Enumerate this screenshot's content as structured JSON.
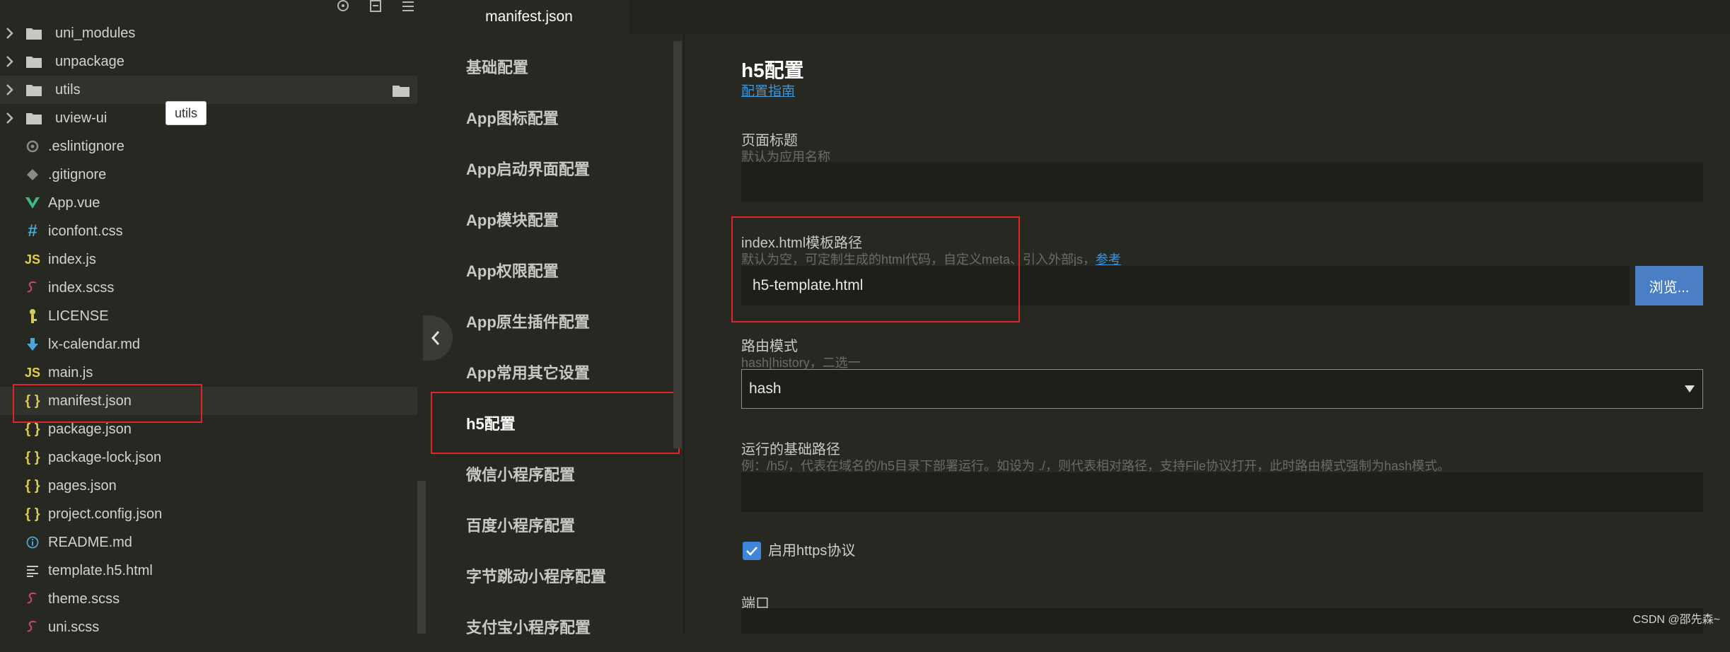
{
  "sidebar": {
    "folders": [
      {
        "name": "uni_modules"
      },
      {
        "name": "unpackage"
      },
      {
        "name": "utils"
      },
      {
        "name": "uview-ui"
      }
    ],
    "files": [
      {
        "name": ".eslintignore",
        "icon": "gear-file-icon"
      },
      {
        "name": ".gitignore",
        "icon": "git-diamond-icon"
      },
      {
        "name": "App.vue",
        "icon": "vue-icon"
      },
      {
        "name": "iconfont.css",
        "icon": "hash-icon"
      },
      {
        "name": "index.js",
        "icon": "js-icon"
      },
      {
        "name": "index.scss",
        "icon": "sass-icon"
      },
      {
        "name": "LICENSE",
        "icon": "person-key-icon"
      },
      {
        "name": "lx-calendar.md",
        "icon": "down-arrow-icon"
      },
      {
        "name": "main.js",
        "icon": "js-icon"
      },
      {
        "name": "manifest.json",
        "icon": "braces-icon"
      },
      {
        "name": "package.json",
        "icon": "braces-icon"
      },
      {
        "name": "package-lock.json",
        "icon": "braces-icon"
      },
      {
        "name": "pages.json",
        "icon": "braces-icon"
      },
      {
        "name": "project.config.json",
        "icon": "braces-icon"
      },
      {
        "name": "README.md",
        "icon": "info-icon"
      },
      {
        "name": "template.h5.html",
        "icon": "lines-icon"
      },
      {
        "name": "theme.scss",
        "icon": "sass-icon"
      },
      {
        "name": "uni.scss",
        "icon": "sass-icon"
      }
    ],
    "js_glyph": "JS",
    "braces_glyph": "{ }",
    "hash_glyph": "#",
    "tooltip": "utils"
  },
  "tab": {
    "label": "manifest.json"
  },
  "nav": {
    "items": [
      "基础配置",
      "App图标配置",
      "App启动界面配置",
      "App模块配置",
      "App权限配置",
      "App原生插件配置",
      "App常用其它设置",
      "h5配置",
      "微信小程序配置",
      "百度小程序配置",
      "字节跳动小程序配置",
      "支付宝小程序配置"
    ],
    "active_index": 7
  },
  "content": {
    "title": "h5配置",
    "guide_link": "配置指南",
    "page_title": {
      "label": "页面标题",
      "hint": "默认为应用名称",
      "value": ""
    },
    "template_path": {
      "label": "index.html模板路径",
      "hint": "默认为空，可定制生成的html代码，自定义meta、引入外部js，",
      "hint_link": "参考",
      "value": "h5-template.html",
      "browse": "浏览..."
    },
    "router_mode": {
      "label": "路由模式",
      "hint": "hash|history，二选一",
      "value": "hash"
    },
    "base_path": {
      "label": "运行的基础路径",
      "hint": "例：/h5/，代表在域名的/h5目录下部署运行。如设为 ./，则代表相对路径，支持File协议打开，此时路由模式强制为hash模式。",
      "value": ""
    },
    "https": {
      "label": "启用https协议",
      "checked": true
    },
    "port": {
      "label": "端口"
    }
  },
  "watermark": "CSDN @邵先森~",
  "colors": {
    "accent": "#4a7fc5",
    "highlight_box": "#e0242b",
    "link": "#3c97dc"
  }
}
